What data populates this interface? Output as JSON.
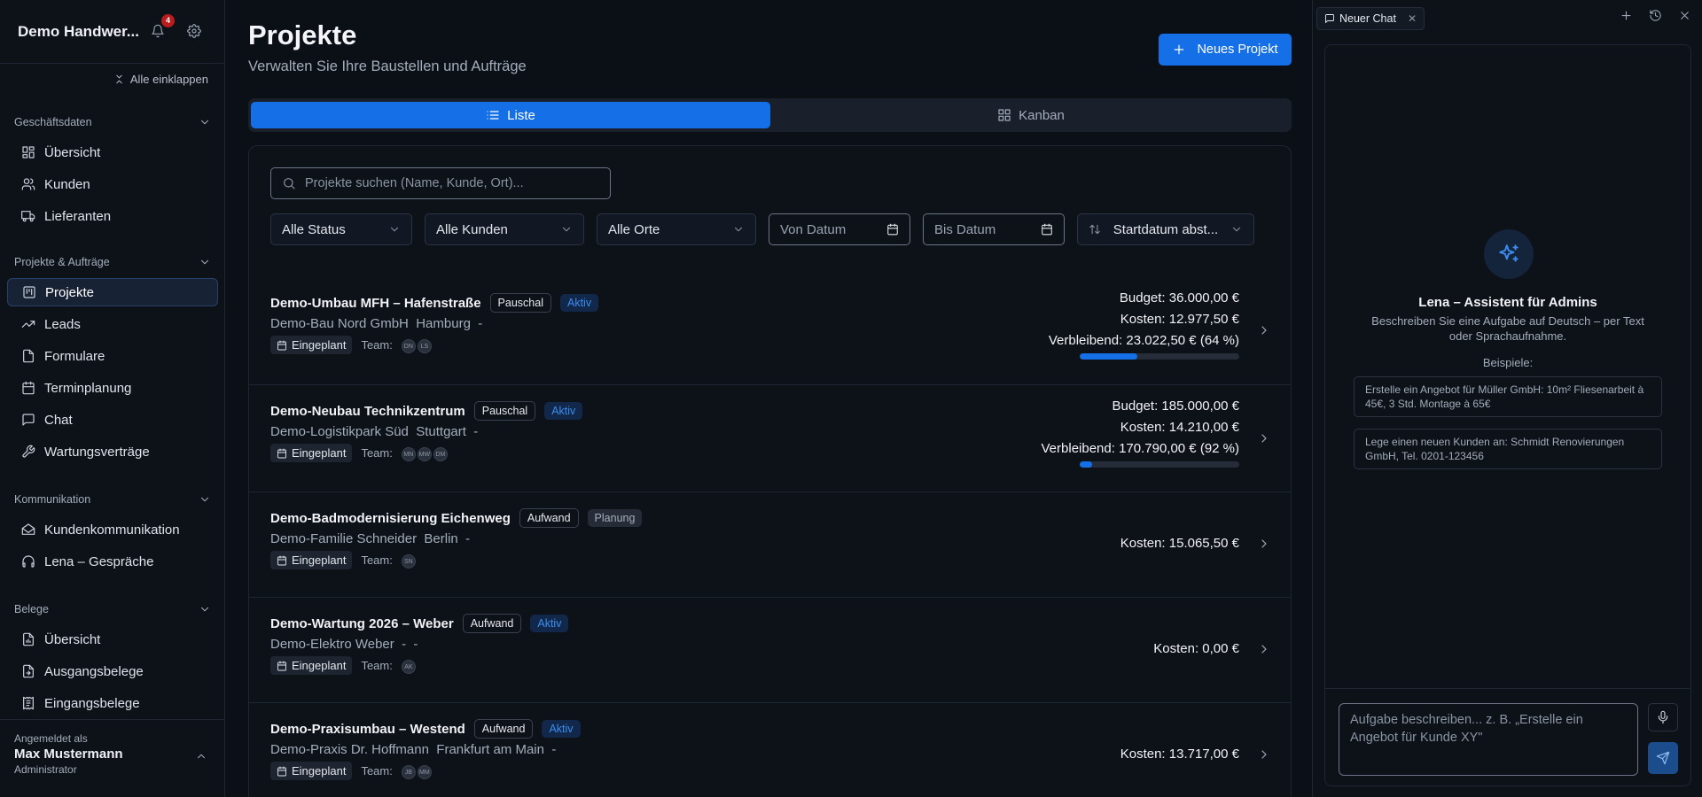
{
  "sidebar": {
    "title": "Demo Handwer...",
    "notifications": "4",
    "collapse_all": "Alle einklappen",
    "sections": [
      {
        "label": "Geschäftsdaten",
        "items": [
          "Übersicht",
          "Kunden",
          "Lieferanten"
        ]
      },
      {
        "label": "Projekte & Aufträge",
        "items": [
          "Projekte",
          "Leads",
          "Formulare",
          "Terminplanung",
          "Chat",
          "Wartungsverträge"
        ]
      },
      {
        "label": "Kommunikation",
        "items": [
          "Kundenkommunikation",
          "Lena – Gespräche"
        ]
      },
      {
        "label": "Belege",
        "items": [
          "Übersicht",
          "Ausgangsbelege",
          "Eingangsbelege"
        ]
      }
    ],
    "active_item": "Projekte",
    "footer": {
      "label": "Angemeldet als",
      "name": "Max Mustermann",
      "role": "Administrator"
    }
  },
  "main": {
    "title": "Projekte",
    "subtitle": "Verwalten Sie Ihre Baustellen und Aufträge",
    "new_button": "Neues Projekt",
    "view_tabs": [
      "Liste",
      "Kanban"
    ],
    "active_view": "Liste",
    "search_placeholder": "Projekte suchen (Name, Kunde, Ort)...",
    "filters": {
      "status": "Alle Status",
      "customers": "Alle Kunden",
      "locations": "Alle Orte",
      "date_from": "Von Datum",
      "date_to": "Bis Datum",
      "sort": "Startdatum abst..."
    },
    "projects": [
      {
        "name": "Demo-Umbau MFH – Hafenstraße",
        "type": "Pauschal",
        "status": "Aktiv",
        "status_kind": "active",
        "customer": "Demo-Bau Nord GmbH  Hamburg  -",
        "phase": "Eingeplant",
        "team_label": "Team:",
        "team": [
          "DN",
          "LS"
        ],
        "budget": "Budget: 36.000,00 €",
        "costs": "Kosten: 12.977,50 €",
        "remaining": "Verbleibend: 23.022,50 € (64 %)",
        "progress": 0.36
      },
      {
        "name": "Demo-Neubau Technikzentrum",
        "type": "Pauschal",
        "status": "Aktiv",
        "status_kind": "active",
        "customer": "Demo-Logistikpark Süd  Stuttgart  -",
        "phase": "Eingeplant",
        "team_label": "Team:",
        "team": [
          "MN",
          "MW",
          "DM"
        ],
        "budget": "Budget: 185.000,00 €",
        "costs": "Kosten: 14.210,00 €",
        "remaining": "Verbleibend: 170.790,00 € (92 %)",
        "progress": 0.08
      },
      {
        "name": "Demo-Badmodernisierung Eichenweg",
        "type": "Aufwand",
        "status": "Planung",
        "status_kind": "plan",
        "customer": "Demo-Familie Schneider  Berlin  -",
        "phase": "Eingeplant",
        "team_label": "Team:",
        "team": [
          "SN"
        ],
        "costs": "Kosten: 15.065,50 €"
      },
      {
        "name": "Demo-Wartung 2026 – Weber",
        "type": "Aufwand",
        "status": "Aktiv",
        "status_kind": "active",
        "customer": "Demo-Elektro Weber  -  -",
        "phase": "Eingeplant",
        "team_label": "Team:",
        "team": [
          "AK"
        ],
        "costs": "Kosten: 0,00 €"
      },
      {
        "name": "Demo-Praxisumbau – Westend",
        "type": "Aufwand",
        "status": "Aktiv",
        "status_kind": "active",
        "customer": "Demo-Praxis Dr. Hoffmann  Frankfurt am Main  -",
        "phase": "Eingeplant",
        "team_label": "Team:",
        "team": [
          "JB",
          "MM"
        ],
        "costs": "Kosten: 13.717,00 €"
      }
    ]
  },
  "chat": {
    "tab_label": "Neuer Chat",
    "assistant_title": "Lena – Assistent für Admins",
    "assistant_desc": "Beschreiben Sie eine Aufgabe auf Deutsch – per Text oder Sprachaufnahme.",
    "examples_label": "Beispiele:",
    "examples": [
      "Erstelle ein Angebot für Müller GmbH: 10m² Fliesenarbeit à 45€, 3 Std. Montage à 65€",
      "Lege einen neuen Kunden an: Schmidt Renovierungen GmbH, Tel. 0201-123456"
    ],
    "input_placeholder": "Aufgabe beschreiben... z. B. „Erstelle ein Angebot für Kunde XY\""
  },
  "colors": {
    "accent": "#1570e8",
    "active_badge": "#3d8df0",
    "badge_red": "#b91c1c"
  }
}
